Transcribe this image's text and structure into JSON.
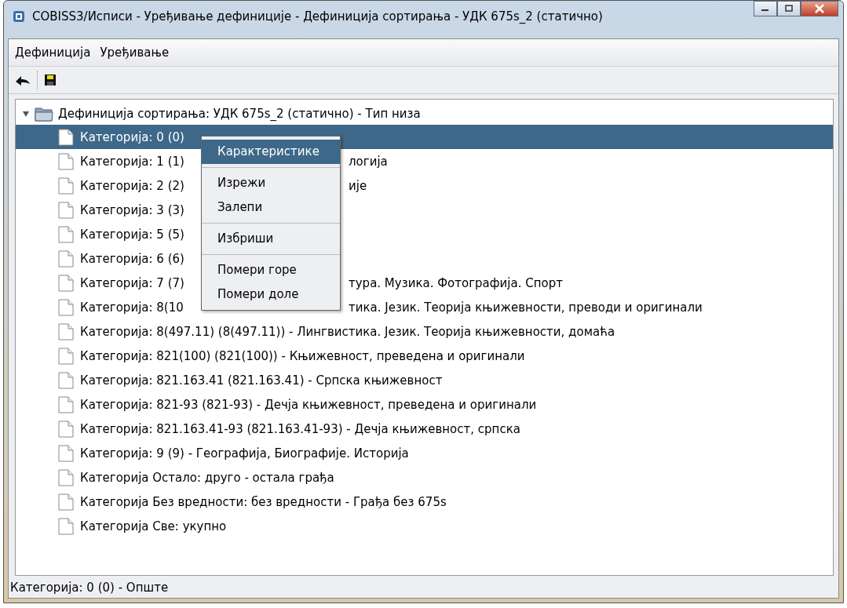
{
  "window": {
    "title": "COBISS3/Исписи - Уређивање дефиниције - Дефиниција сортирања - УДК 675s_2 (статично)"
  },
  "menu_bar": [
    "Дефиниција",
    "Уређивање"
  ],
  "tree": {
    "root": {
      "label": "Дефиниција сортирања: УДК 675s_2 (статично) - Тип низа",
      "expanded": true,
      "children": [
        {
          "label": "Категорија: 0 (0)",
          "selected": true
        },
        {
          "label": "Категорија: 1 (1)",
          "label_after_menu": "логија",
          "selected": false
        },
        {
          "label": "Категорија: 2 (2)",
          "label_after_menu": "ије",
          "selected": false
        },
        {
          "label": "Категорија: 3 (3)",
          "selected": false
        },
        {
          "label": "Категорија: 5 (5)",
          "selected": false
        },
        {
          "label": "Категорија: 6 (6)",
          "selected": false
        },
        {
          "label": "Категорија: 7 (7)",
          "label_after_menu": "тура. Музика. Фотографија. Спорт",
          "selected": false
        },
        {
          "label": "Категорија: 8(10",
          "label_after_menu": "тика. Језик. Теорија књижевности, преводи и оригинали",
          "selected": false
        },
        {
          "label": "Категорија: 8(497.11) (8(497.11)) - Лингвистика. Језик. Теорија књижевности, домаћа",
          "selected": false
        },
        {
          "label": "Категорија: 821(100) (821(100)) - Књижевност, преведена и оригинали",
          "selected": false
        },
        {
          "label": "Категорија: 821.163.41 (821.163.41) - Српска књижевност",
          "selected": false
        },
        {
          "label": "Категорија: 821-93 (821-93) - Дечја књижевност, преведена и оригинали",
          "selected": false
        },
        {
          "label": "Категорија: 821.163.41-93 (821.163.41-93) - Дечја књижевност, српска",
          "selected": false
        },
        {
          "label": "Категорија: 9 (9) - Географија, Биографије. Историја",
          "selected": false
        },
        {
          "label": "Категорија Остало: друго - остала грађа",
          "selected": false
        },
        {
          "label": "Категорија Без вредности: без вредности - Грађа без 675s",
          "selected": false
        },
        {
          "label": "Категорија Све: укупно",
          "selected": false
        }
      ]
    }
  },
  "context_menu": [
    {
      "kind": "item",
      "label": "Карактеристике",
      "selected": true
    },
    {
      "kind": "separator"
    },
    {
      "kind": "item",
      "label": "Изрежи",
      "selected": false
    },
    {
      "kind": "item",
      "label": "Залепи",
      "selected": false
    },
    {
      "kind": "separator"
    },
    {
      "kind": "item",
      "label": "Избриши",
      "selected": false
    },
    {
      "kind": "separator"
    },
    {
      "kind": "item",
      "label": "Помери горе",
      "selected": false
    },
    {
      "kind": "item",
      "label": "Помери доле",
      "selected": false
    }
  ],
  "status_bar": "Категорија: 0 (0) - Опште"
}
